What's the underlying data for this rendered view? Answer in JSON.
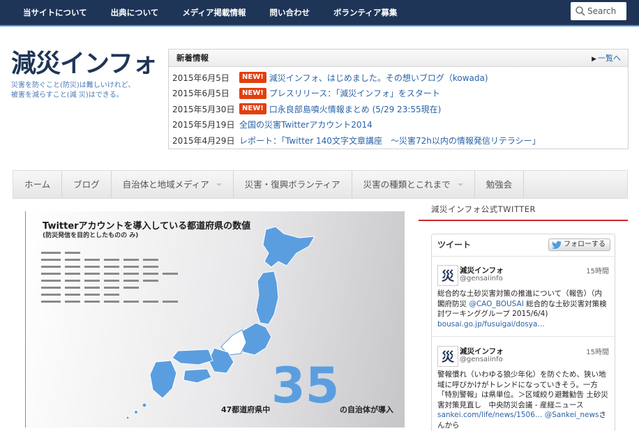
{
  "topnav": {
    "items": [
      "当サイトについて",
      "出典について",
      "メディア掲載情報",
      "問い合わせ",
      "ボランティア募集"
    ],
    "search_placeholder": "Search"
  },
  "logo": {
    "text": "減災インフォ",
    "tagline_1": "災害を防ぐこと(防災)は難しいけれど、",
    "tagline_2": "被害を減らすこと(減 災)はできる。"
  },
  "news": {
    "title": "新着情報",
    "more": "一覧へ",
    "badge": "NEW!",
    "items": [
      {
        "date": "2015年6月5日",
        "is_new": true,
        "text": "減災インフォ、はじめました。その想いブログ（kowada)"
      },
      {
        "date": "2015年6月5日",
        "is_new": true,
        "text": "プレスリリース：「減災インフォ」をスタート"
      },
      {
        "date": "2015年5月30日",
        "is_new": true,
        "text": "口永良部島噴火情報まとめ (5/29 23:55現在)"
      },
      {
        "date": "2015年5月19日",
        "is_new": false,
        "text": "全国の災害Twitterアカウント2014"
      },
      {
        "date": "2015年4月29日",
        "is_new": false,
        "text": "レポート：「Twitter 140文字文章講座　〜災害72h以内の情報発信リテラシー」"
      }
    ]
  },
  "mainnav": {
    "items": [
      {
        "label": "ホーム",
        "dropdown": false
      },
      {
        "label": "ブログ",
        "dropdown": false
      },
      {
        "label": "自治体と地域メディア",
        "dropdown": true
      },
      {
        "label": "災害・復興ボランティア",
        "dropdown": false
      },
      {
        "label": "災害の種類とこれまで",
        "dropdown": true
      },
      {
        "label": "勉強会",
        "dropdown": false
      }
    ]
  },
  "feature": {
    "title": "Twitterアカウントを導入している都道府県の数値",
    "subtitle": "(防災発信を目的としたものの み)",
    "number": "35",
    "caption_left": "47都道府県中",
    "caption_right": "の自治体が導入",
    "map_color": "#5b9ee0"
  },
  "sidebar": {
    "heading": "減災インフォ公式TWITTER",
    "widget_title": "ツイート",
    "follow_label": "フォローする",
    "tweets": [
      {
        "avatar": "災",
        "name": "減災インフォ",
        "handle": "@gensaiinfo",
        "time": "15時間",
        "text_1": "総合的な土砂災害対策の推進について（報告）（内閣府防災 ",
        "mention": "@CAO_BOUSAI",
        "text_2": " 総合的な土砂災害対策検討ワーキンググループ 2015/6/4)",
        "link": "bousai.go.jp/fusuigai/dosya…",
        "text_3": "",
        "mention_2": "",
        "text_4": ""
      },
      {
        "avatar": "災",
        "name": "減災インフォ",
        "handle": "@gensaiinfo",
        "time": "15時間",
        "text_1": "警報慣れ（いわゆる狼少年化）を防ぐため、狭い地域に呼びかけがトレンドになっていきそう。一方「特別警報」は県単位。＞区域絞り避難勧告 土砂災害対策見直し　中央防災会議 - 産経ニュース ",
        "mention": "",
        "text_2": "",
        "link": "sankei.com/life/news/1506…",
        "text_3": " ",
        "mention_2": "@Sankei_news",
        "text_4": "さんから"
      }
    ]
  },
  "colors": {
    "topbar": "#1f3558",
    "accent": "#c9282d",
    "link": "#2a62a8",
    "badge": "#e1400f"
  }
}
